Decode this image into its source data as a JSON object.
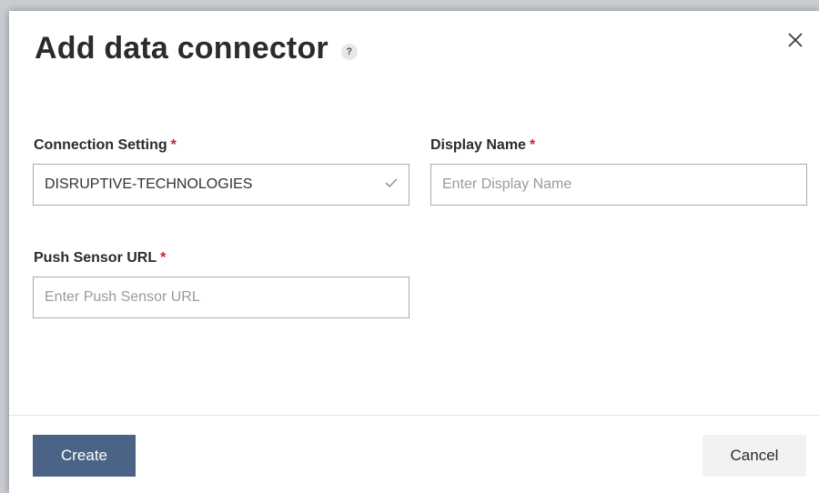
{
  "dialog": {
    "title": "Add data connector",
    "help_glyph": "?",
    "close_glyph": "✕"
  },
  "form": {
    "connection_setting": {
      "label": "Connection Setting",
      "required": "*",
      "value": "DISRUPTIVE-TECHNOLOGIES"
    },
    "display_name": {
      "label": "Display Name",
      "required": "*",
      "placeholder": "Enter Display Name"
    },
    "push_sensor_url": {
      "label": "Push Sensor URL",
      "required": "*",
      "placeholder": "Enter Push Sensor URL"
    }
  },
  "footer": {
    "create_label": "Create",
    "cancel_label": "Cancel"
  },
  "colors": {
    "primary_button": "#4b6386",
    "required_marker": "#c4262e"
  }
}
